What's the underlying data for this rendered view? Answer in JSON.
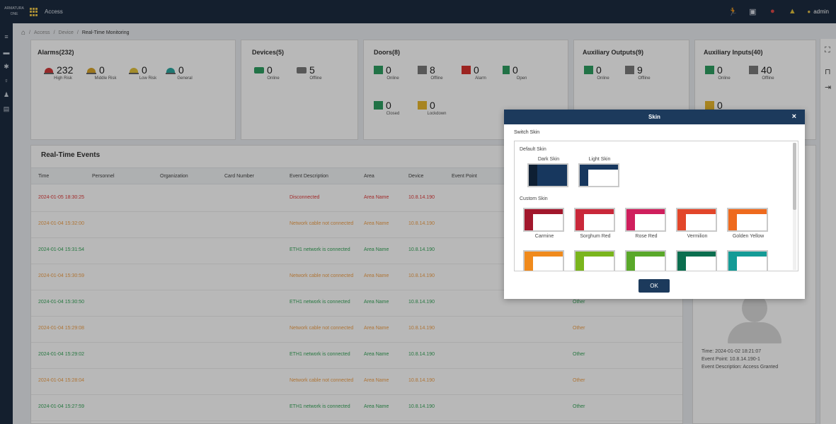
{
  "topbar": {
    "logo": "ARMATURA ONE",
    "app_name": "Access",
    "user": "admin",
    "icons": [
      "person-run-icon",
      "monitor-icon",
      "alarm-icon",
      "bell-icon",
      "user-icon"
    ]
  },
  "sidebar": {
    "icons": [
      "menu-icon",
      "car-icon",
      "gear-icon",
      "key-icon",
      "users-icon",
      "report-icon"
    ]
  },
  "breadcrumb": {
    "items": [
      "Access",
      "Device",
      "Real-Time Monitoring"
    ]
  },
  "alarms": {
    "title": "Alarms(232)",
    "stats": [
      {
        "value": "232",
        "label": "High Risk"
      },
      {
        "value": "0",
        "label": "Middle Risk"
      },
      {
        "value": "0",
        "label": "Low Risk"
      },
      {
        "value": "0",
        "label": "General"
      }
    ]
  },
  "devices": {
    "title": "Devices(5)",
    "stats": [
      {
        "value": "0",
        "label": "Online"
      },
      {
        "value": "5",
        "label": "Offline"
      }
    ]
  },
  "doors": {
    "title": "Doors(8)",
    "stats": [
      {
        "value": "0",
        "label": "Online"
      },
      {
        "value": "8",
        "label": "Offline"
      },
      {
        "value": "0",
        "label": "Alarm"
      },
      {
        "value": "0",
        "label": "Open"
      },
      {
        "value": "0",
        "label": "Closed"
      },
      {
        "value": "0",
        "label": "Lockdown"
      }
    ]
  },
  "aux_out": {
    "title": "Auxiliary Outputs(9)",
    "stats": [
      {
        "value": "0",
        "label": "Online"
      },
      {
        "value": "9",
        "label": "Offline"
      }
    ]
  },
  "aux_in": {
    "title": "Auxiliary Inputs(40)",
    "stats": [
      {
        "value": "0",
        "label": "Online"
      },
      {
        "value": "40",
        "label": "Offline"
      },
      {
        "value": "0",
        "label": ""
      }
    ]
  },
  "events": {
    "title": "Real-Time Events",
    "columns": [
      "Time",
      "Personnel",
      "Organization",
      "Card Number",
      "Event Description",
      "Area",
      "Device",
      "Event Point"
    ],
    "rows": [
      {
        "time": "2024-01-05 18:30:25",
        "desc": "Disconnected",
        "area": "Area Name",
        "device": "10.8.14.190",
        "other": "",
        "color": "red"
      },
      {
        "time": "2024-01-04 15:32:00",
        "desc": "Network cable not connected",
        "area": "Area Name",
        "device": "10.8.14.190",
        "other": "",
        "color": "orange"
      },
      {
        "time": "2024-01-04 15:31:54",
        "desc": "ETH1 network is connected",
        "area": "Area Name",
        "device": "10.8.14.190",
        "other": "",
        "color": "green"
      },
      {
        "time": "2024-01-04 15:30:59",
        "desc": "Network cable not connected",
        "area": "Area Name",
        "device": "10.8.14.190",
        "other": "",
        "color": "orange"
      },
      {
        "time": "2024-01-04 15:30:50",
        "desc": "ETH1 network is connected",
        "area": "Area Name",
        "device": "10.8.14.190",
        "other": "Other",
        "color": "green"
      },
      {
        "time": "2024-01-04 15:29:08",
        "desc": "Network cable not connected",
        "area": "Area Name",
        "device": "10.8.14.190",
        "other": "Other",
        "color": "orange"
      },
      {
        "time": "2024-01-04 15:29:02",
        "desc": "ETH1 network is connected",
        "area": "Area Name",
        "device": "10.8.14.190",
        "other": "Other",
        "color": "green"
      },
      {
        "time": "2024-01-04 15:28:04",
        "desc": "Network cable not connected",
        "area": "Area Name",
        "device": "10.8.14.190",
        "other": "Other",
        "color": "orange"
      },
      {
        "time": "2024-01-04 15:27:59",
        "desc": "ETH1 network is connected",
        "area": "Area Name",
        "device": "10.8.14.190",
        "other": "Other",
        "color": "green"
      }
    ]
  },
  "last_event": {
    "time": "Time: 2024-01-02 18:21:07",
    "point": "Event Point: 10.8.14.190-1",
    "desc": "Event Description: Access Granted"
  },
  "modal": {
    "title": "Skin",
    "close": "×",
    "switch_label": "Switch Skin",
    "default_label": "Default Skin",
    "custom_label": "Custom Skin",
    "ok": "OK",
    "default_skins": [
      {
        "name": "Dark Skin",
        "top": "#17375e",
        "side": "#0e1f33",
        "pane": "#17375e"
      },
      {
        "name": "Light Skin",
        "top": "#17375e",
        "side": "#17375e",
        "pane": "#ffffff"
      }
    ],
    "custom_skins": [
      {
        "name": "Carmine",
        "color": "#a1172c"
      },
      {
        "name": "Sorghum Red",
        "color": "#c9283a"
      },
      {
        "name": "Rose Red",
        "color": "#cf1f5d"
      },
      {
        "name": "Vermilion",
        "color": "#e2462a"
      },
      {
        "name": "Golden Yellow",
        "color": "#ee6a1e"
      },
      {
        "name": "",
        "color": "#f08a1c"
      },
      {
        "name": "",
        "color": "#7ab51d"
      },
      {
        "name": "",
        "color": "#5aa82a"
      },
      {
        "name": "",
        "color": "#0b6e4f"
      },
      {
        "name": "",
        "color": "#149b96"
      }
    ]
  }
}
